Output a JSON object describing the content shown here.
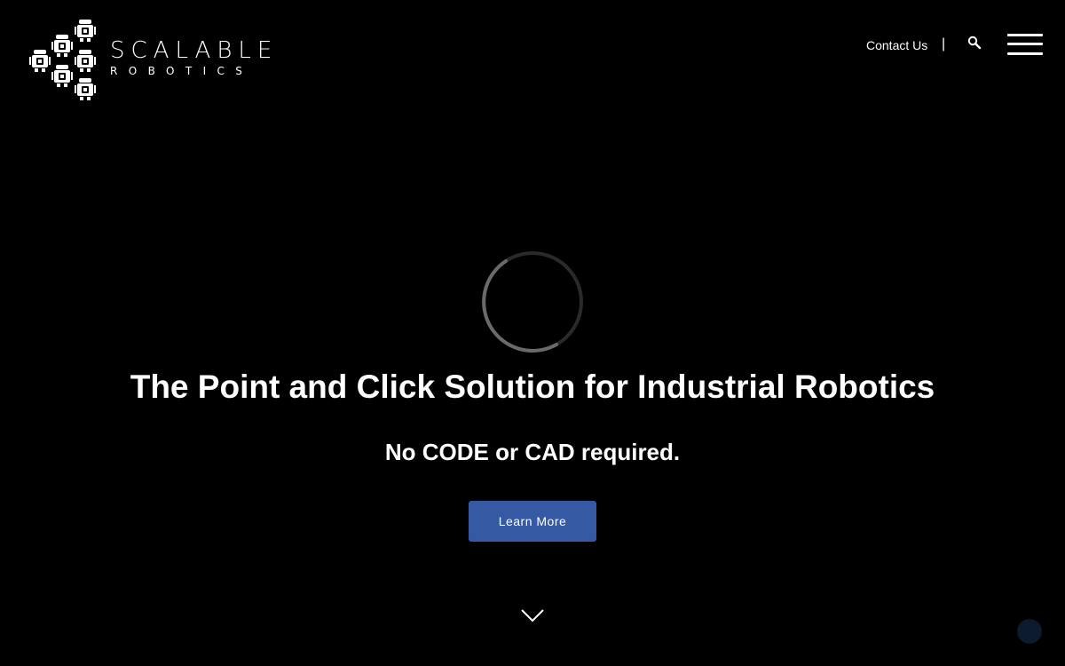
{
  "brand": {
    "name": "SCALABLE",
    "subtitle": "ROBOTICS",
    "logo_icon": "robot-cluster-icon"
  },
  "header": {
    "contact_label": "Contact Us",
    "separator": "|",
    "search_icon": "search-icon",
    "menu_icon": "hamburger-menu-icon"
  },
  "hero": {
    "title": "The Point and Click Solution for Industrial Robotics",
    "subtitle": "No CODE or CAD required.",
    "cta_label": "Learn More",
    "loading_icon": "loading-spinner-icon",
    "scroll_icon": "chevron-down-icon"
  },
  "colors": {
    "background": "#000000",
    "text": "#ffffff",
    "cta": "#3559a3",
    "chat_widget": "#0b1a2c"
  },
  "chat": {
    "icon": "chat-bubble-icon"
  }
}
